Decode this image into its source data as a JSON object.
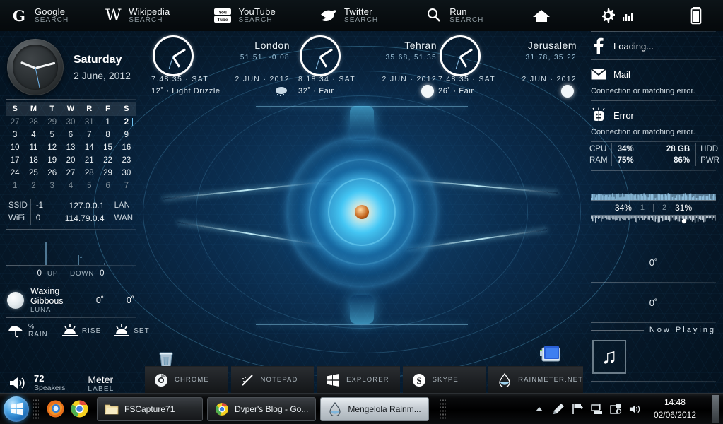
{
  "topbar": {
    "items": [
      {
        "title": "Google",
        "sub": "SEARCH",
        "icon": "google-g-icon"
      },
      {
        "title": "Wikipedia",
        "sub": "SEARCH",
        "icon": "wikipedia-w-icon"
      },
      {
        "title": "YouTube",
        "sub": "SEARCH",
        "icon": "youtube-icon"
      },
      {
        "title": "Twitter",
        "sub": "SEARCH",
        "icon": "twitter-bird-icon"
      },
      {
        "title": "Run",
        "sub": "SEARCH",
        "icon": "magnifier-icon"
      }
    ],
    "shortcuts": [
      {
        "icon": "home-icon"
      },
      {
        "icon": "gear-icon"
      },
      {
        "icon": "battery-icon"
      },
      {
        "icon": "notes-icon"
      }
    ]
  },
  "clock": {
    "day_of_week": "Saturday",
    "date": "2 June, 2012"
  },
  "calendar": {
    "headers": [
      "S",
      "M",
      "T",
      "W",
      "R",
      "F",
      "S"
    ],
    "weeks": [
      [
        {
          "d": "27",
          "o": true
        },
        {
          "d": "28",
          "o": true
        },
        {
          "d": "29",
          "o": true
        },
        {
          "d": "30",
          "o": true
        },
        {
          "d": "31",
          "o": true
        },
        {
          "d": "1",
          "o": false
        },
        {
          "d": "2",
          "o": false,
          "today": true
        }
      ],
      [
        {
          "d": "3",
          "o": false
        },
        {
          "d": "4",
          "o": false
        },
        {
          "d": "5",
          "o": false
        },
        {
          "d": "6",
          "o": false
        },
        {
          "d": "7",
          "o": false
        },
        {
          "d": "8",
          "o": false
        },
        {
          "d": "9",
          "o": false
        }
      ],
      [
        {
          "d": "10",
          "o": false
        },
        {
          "d": "11",
          "o": false
        },
        {
          "d": "12",
          "o": false
        },
        {
          "d": "13",
          "o": false
        },
        {
          "d": "14",
          "o": false
        },
        {
          "d": "15",
          "o": false
        },
        {
          "d": "16",
          "o": false
        }
      ],
      [
        {
          "d": "17",
          "o": false
        },
        {
          "d": "18",
          "o": false
        },
        {
          "d": "19",
          "o": false
        },
        {
          "d": "20",
          "o": false
        },
        {
          "d": "21",
          "o": false
        },
        {
          "d": "22",
          "o": false
        },
        {
          "d": "23",
          "o": false
        }
      ],
      [
        {
          "d": "24",
          "o": false
        },
        {
          "d": "25",
          "o": false
        },
        {
          "d": "26",
          "o": false
        },
        {
          "d": "27",
          "o": false
        },
        {
          "d": "28",
          "o": false
        },
        {
          "d": "29",
          "o": false
        },
        {
          "d": "30",
          "o": false
        }
      ],
      [
        {
          "d": "1",
          "o": true
        },
        {
          "d": "2",
          "o": true
        },
        {
          "d": "3",
          "o": true
        },
        {
          "d": "4",
          "o": true
        },
        {
          "d": "5",
          "o": true
        },
        {
          "d": "6",
          "o": true
        },
        {
          "d": "7",
          "o": true
        }
      ]
    ]
  },
  "network": {
    "row1": {
      "label": "SSID",
      "value": "-1",
      "ip": "127.0.0.1",
      "tag": "LAN"
    },
    "row2": {
      "label": "WiFi",
      "value": "0",
      "ip": "114.79.0.4",
      "tag": "WAN"
    },
    "up_value": "0",
    "up_label": "UP",
    "down_label": "DOWN",
    "down_value": "0"
  },
  "moon": {
    "phase": "Waxing Gibbous",
    "label": "LUNA",
    "value1": "0˚",
    "value2": "0˚"
  },
  "sun": {
    "rain_pct": "%",
    "rain_label": "RAIN",
    "rise_label": "RISE",
    "set_label": "SET"
  },
  "volume": {
    "level": "72",
    "device": "Speakers",
    "meter_title": "Meter",
    "meter_label": "LABEL"
  },
  "weather": {
    "cities": [
      {
        "name": "London",
        "coords": "51.51, -0.08",
        "time": "7.48.35",
        "dow": "SAT",
        "date_day": "2 JUN",
        "date_year": "2012",
        "temp": "12˚",
        "condition": "Light Drizzle",
        "icon": "drizzle-cloud-icon"
      },
      {
        "name": "Tehran",
        "coords": "35.68, 51.35",
        "time": "8.18.34",
        "dow": "SAT",
        "date_day": "2 JUN",
        "date_year": "2012",
        "temp": "32˚",
        "condition": "Fair",
        "icon": "sun-icon"
      },
      {
        "name": "Jerusalem",
        "coords": "31.78, 35.22",
        "time": "7.48.35",
        "dow": "SAT",
        "date_day": "2 JUN",
        "date_year": "2012",
        "temp": "26˚",
        "condition": "Fair",
        "icon": "sun-icon"
      }
    ]
  },
  "right": {
    "facebook": {
      "icon": "facebook-icon",
      "title": "Loading..."
    },
    "mail": {
      "icon": "mail-envelope-icon",
      "title": "Mail",
      "body": "Connection or matching error."
    },
    "error": {
      "icon": "alarm-clock-icon",
      "title": "Error",
      "body": "Connection or matching error."
    },
    "stats": {
      "cpu_key": "CPU",
      "cpu_val": "34%",
      "hdd_val": "28 GB",
      "hdd_key": "HDD",
      "ram_key": "RAM",
      "ram_val": "75%",
      "pwr_val": "86%",
      "pwr_key": "PWR"
    },
    "cores": {
      "core1_pct": "34%",
      "core1_idx": "1",
      "core2_idx": "2",
      "core2_pct": "31%"
    },
    "temps": {
      "t1": "0˚",
      "t2": "0˚"
    },
    "now_playing": {
      "label": "Now Playing",
      "art_icon": "music-note-icon"
    }
  },
  "dock": {
    "items": [
      {
        "label": "CHROME",
        "icon": "chrome-icon"
      },
      {
        "label": "NOTEPAD",
        "icon": "notepad-pencil-icon"
      },
      {
        "label": "EXPLORER",
        "icon": "windows-explorer-icon"
      },
      {
        "label": "SKYPE",
        "icon": "skype-icon"
      },
      {
        "label": "RAINMETER.NET",
        "icon": "rainmeter-drop-icon"
      }
    ]
  },
  "desktop_icons": [
    {
      "name": "recycle-bin-icon"
    },
    {
      "name": "computer-icon"
    }
  ],
  "taskbar": {
    "start": {
      "icon": "windows-start-orb"
    },
    "quicklaunch": [
      {
        "icon": "firefox-icon"
      },
      {
        "icon": "chrome-icon"
      }
    ],
    "buttons": [
      {
        "label": "FSCapture71",
        "icon": "folder-icon",
        "active": false
      },
      {
        "label": "Dvper's Blog - Go...",
        "icon": "chrome-icon",
        "active": false
      },
      {
        "label": "Mengelola Rainm...",
        "icon": "rainmeter-drop-icon",
        "active": true
      }
    ],
    "tray": [
      {
        "icon": "show-hidden-icons-chevron"
      },
      {
        "icon": "pen-icon"
      },
      {
        "icon": "flag-action-center-icon"
      },
      {
        "icon": "network-icon"
      },
      {
        "icon": "safely-remove-icon"
      },
      {
        "icon": "volume-icon"
      }
    ],
    "time": "14:48",
    "date": "02/06/2012"
  },
  "colors": {
    "accent": "#5ac8f5",
    "taskbar_bg": "#000000",
    "text": "#e8eef2"
  }
}
